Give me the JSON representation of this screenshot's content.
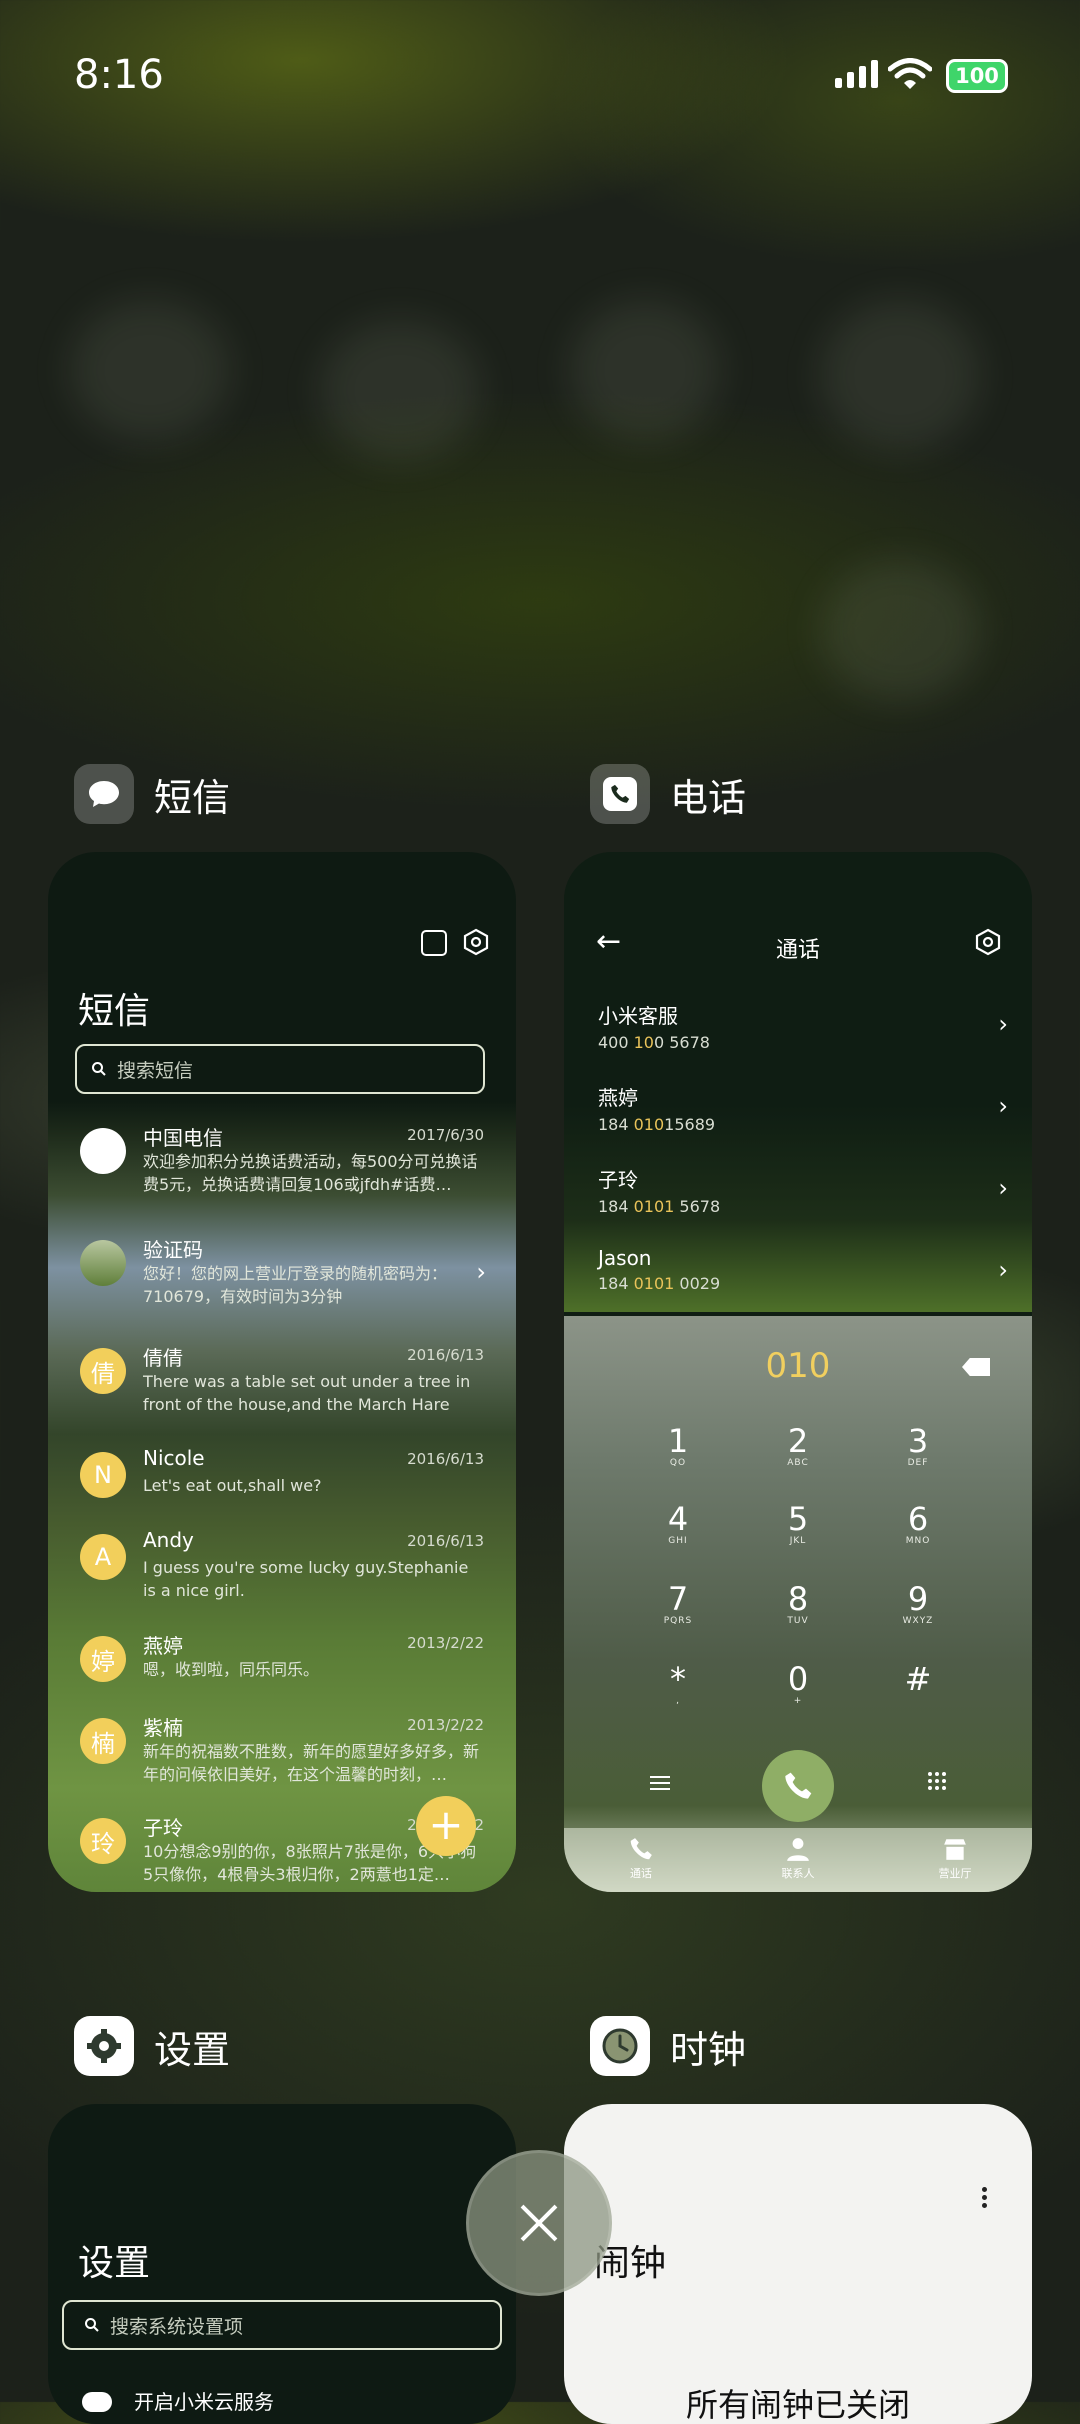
{
  "status": {
    "time": "8:16",
    "battery": "100"
  },
  "apps": {
    "sms": {
      "label": "短信",
      "title": "短信",
      "search_placeholder": "搜索短信",
      "messages": [
        {
          "avatar": "",
          "name": "中国电信",
          "date": "2017/6/30",
          "snippet": "欢迎参加积分兑换话费活动，每500分可兑换话费5元，兑换话费请回复106或jfdh#话费…"
        },
        {
          "avatar": "",
          "name": "验证码",
          "date": "",
          "snippet": "您好！您的网上营业厅登录的随机密码为：710679，有效时间为3分钟"
        },
        {
          "avatar": "倩",
          "name": "倩倩",
          "date": "2016/6/13",
          "snippet": "There was a table set out under a tree in front of the house,and the March Hare an…"
        },
        {
          "avatar": "N",
          "name": "Nicole",
          "date": "2016/6/13",
          "snippet": "Let's eat out,shall we?"
        },
        {
          "avatar": "A",
          "name": "Andy",
          "date": "2016/6/13",
          "snippet": "I guess you're some lucky guy.Stephanie is a nice girl."
        },
        {
          "avatar": "婷",
          "name": "燕婷",
          "date": "2013/2/22",
          "snippet": "嗯，收到啦，同乐同乐。"
        },
        {
          "avatar": "楠",
          "name": "紫楠",
          "date": "2013/2/22",
          "snippet": "新年的祝福数不胜数，新年的愿望好多好多，新年的问候依旧美好，在这个温馨的时刻，…"
        },
        {
          "avatar": "玲",
          "name": "子玲",
          "date": "2013/2/22",
          "snippet": "10分想念9别的你，8张照片7张是你，6只小狗5只像你，4根骨头3根归你，2两薏也1定…"
        }
      ],
      "fab": "+"
    },
    "phone": {
      "label": "电话",
      "header_title": "通话",
      "calls": [
        {
          "name": "小米客服",
          "pre": "400 ",
          "hl": "10",
          "post": "0 5678"
        },
        {
          "name": "燕婷",
          "pre": "184 ",
          "hl": "010",
          "post": "15689"
        },
        {
          "name": "子玲",
          "pre": "184 ",
          "hl": "0101",
          "post": " 5678"
        },
        {
          "name": "Jason",
          "pre": "184 ",
          "hl": "0101",
          "post": " 0029"
        }
      ],
      "dialed": "010",
      "keys": [
        {
          "d": "1",
          "l": "QO"
        },
        {
          "d": "2",
          "l": "ABC"
        },
        {
          "d": "3",
          "l": "DEF"
        },
        {
          "d": "4",
          "l": "GHI"
        },
        {
          "d": "5",
          "l": "JKL"
        },
        {
          "d": "6",
          "l": "MNO"
        },
        {
          "d": "7",
          "l": "PQRS"
        },
        {
          "d": "8",
          "l": "TUV"
        },
        {
          "d": "9",
          "l": "WXYZ"
        },
        {
          "d": "*",
          "l": ","
        },
        {
          "d": "0",
          "l": "+"
        },
        {
          "d": "#",
          "l": ""
        }
      ],
      "tabs": [
        "通话",
        "联系人",
        "营业厅"
      ]
    },
    "settings": {
      "label": "设置",
      "title": "设置",
      "search_placeholder": "搜索系统设置项",
      "first_item": "开启小米云服务"
    },
    "clock": {
      "label": "时钟",
      "title": "闹钟",
      "empty": "所有闹钟已关闭"
    }
  }
}
